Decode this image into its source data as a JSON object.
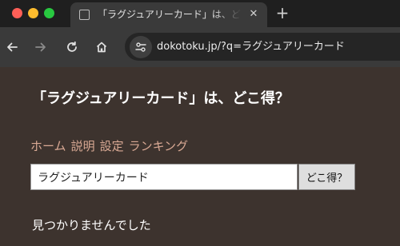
{
  "browser": {
    "tab": {
      "title": "「ラグジュアリーカード」は、どこ得？",
      "close": "✕"
    },
    "new_tab": "+",
    "url": "dokotoku.jp/?q=ラグジュアリーカード",
    "icons": [
      "back-arrow-icon",
      "forward-arrow-icon",
      "reload-icon",
      "home-icon",
      "site-info-icon",
      "favicon-icon"
    ]
  },
  "page": {
    "title": "「ラグジュアリーカード」は、どこ得？",
    "nav": [
      {
        "label": "ホーム"
      },
      {
        "label": "説明"
      },
      {
        "label": "設定"
      },
      {
        "label": "ランキング"
      }
    ],
    "search": {
      "value": "ラグジュアリーカード",
      "button_label": "どこ得？"
    },
    "result_message": "見つかりませんでした"
  },
  "colors": {
    "background": "#3d332e",
    "link": "#d9a994",
    "chrome_dark": "#1f1f1f",
    "chrome_toolbar": "#3a3a3a"
  }
}
